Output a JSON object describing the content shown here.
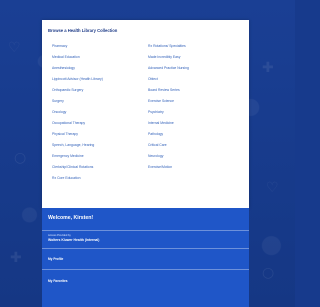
{
  "panel": {
    "title": "Browse a Health Library Collection",
    "left_items": [
      "Pharmacy",
      "Medical Education",
      "Anesthesiology",
      "Lippincott Advisor (Health Library)",
      "Orthopaedic Surgery",
      "Surgery",
      "Oncology",
      "Occupational Therapy",
      "Physical Therapy",
      "Speech, Language, Hearing",
      "Emergency Medicine",
      "Clerkship/Clinical Rotations",
      "Rx Core Education"
    ],
    "right_items": [
      "Rx Rotations/ Specialties",
      "Made Incredibly Easy",
      "Advanced Practice Nursing",
      "Oblect",
      "Board Review Series",
      "Exercise Science",
      "Psychiatry",
      "Internal Medicine",
      "Pathology",
      "Critical Care",
      "Neurology",
      "Exercise/Motion"
    ]
  },
  "welcome": {
    "title": "Welcome, Kirsten!",
    "institution_label": "Access Provided by",
    "institution_value": "Wolters Kluwer Health (Internal)",
    "profile_link": "My Profile",
    "favorites_link": "My Favorites"
  },
  "colors": {
    "background": "#173a8c",
    "panel": "#ffffff",
    "link": "#2f5fb8",
    "welcome_panel": "#1f56c8"
  }
}
